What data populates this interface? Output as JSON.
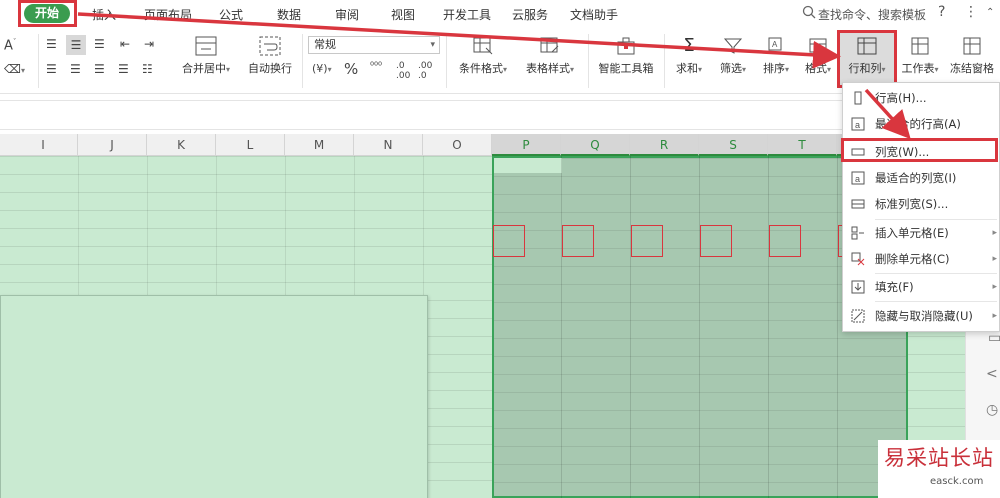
{
  "menu": {
    "items": [
      "开始",
      "插入",
      "页面布局",
      "公式",
      "数据",
      "审阅",
      "视图",
      "开发工具",
      "云服务",
      "文档助手"
    ],
    "search": "查找命令、搜索模板",
    "help": "?",
    "more": "⋮"
  },
  "ribbon": {
    "merge": "合并居中",
    "wrap": "自动换行",
    "number_format": "常规",
    "currency": "¥",
    "percent": "%",
    "cond_format": "条件格式",
    "table_style": "表格样式",
    "smart_toolbox": "智能工具箱",
    "sum": "求和",
    "filter": "筛选",
    "sort": "排序",
    "format": "格式",
    "row_col": "行和列",
    "worksheet": "工作表",
    "freeze": "冻结窗格"
  },
  "columns": [
    "I",
    "J",
    "K",
    "L",
    "M",
    "N",
    "O",
    "P",
    "Q",
    "R",
    "S",
    "T"
  ],
  "selected_columns": [
    "P",
    "Q",
    "R",
    "S",
    "T"
  ],
  "dropdown": {
    "items": [
      {
        "label": "行高(H)...",
        "icon": "row-height-icon"
      },
      {
        "label": "最适合的行高(A)",
        "icon": "autofit-row-icon"
      },
      {
        "label": "列宽(W)...",
        "icon": "column-width-icon"
      },
      {
        "label": "最适合的列宽(I)",
        "icon": "autofit-column-icon"
      },
      {
        "label": "标准列宽(S)...",
        "icon": "standard-width-icon"
      },
      {
        "label": "插入单元格(E)",
        "icon": "insert-cells-icon"
      },
      {
        "label": "删除单元格(C)",
        "icon": "delete-cells-icon"
      },
      {
        "label": "填充(F)",
        "icon": "fill-icon"
      },
      {
        "label": "隐藏与取消隐藏(U)",
        "icon": "hide-unhide-icon"
      }
    ]
  },
  "watermark": {
    "title": "易采站长站",
    "url": "easck.com"
  },
  "colors": {
    "accent": "#3a9c4f",
    "highlight": "#d9363e",
    "sheet": "#c9ead1",
    "selection": "#a7c8b0"
  }
}
